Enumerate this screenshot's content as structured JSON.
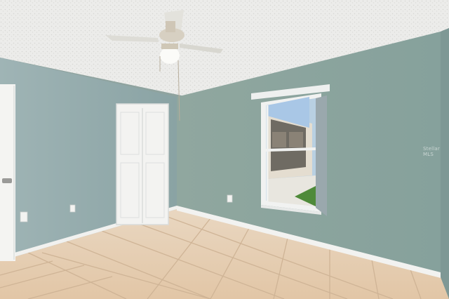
{
  "photo": {
    "subject": "empty-bedroom",
    "watermark": "Stellar MLS"
  },
  "colors": {
    "wall": "#8ea5a2",
    "ceiling": "#eeeeec",
    "floor_tile": "#e6cdb0",
    "grout": "#cdb294",
    "trim": "#f2f2f0"
  },
  "icons": [
    "ceiling-fan-icon",
    "closet-door-icon",
    "window-icon",
    "outlet-icon"
  ]
}
